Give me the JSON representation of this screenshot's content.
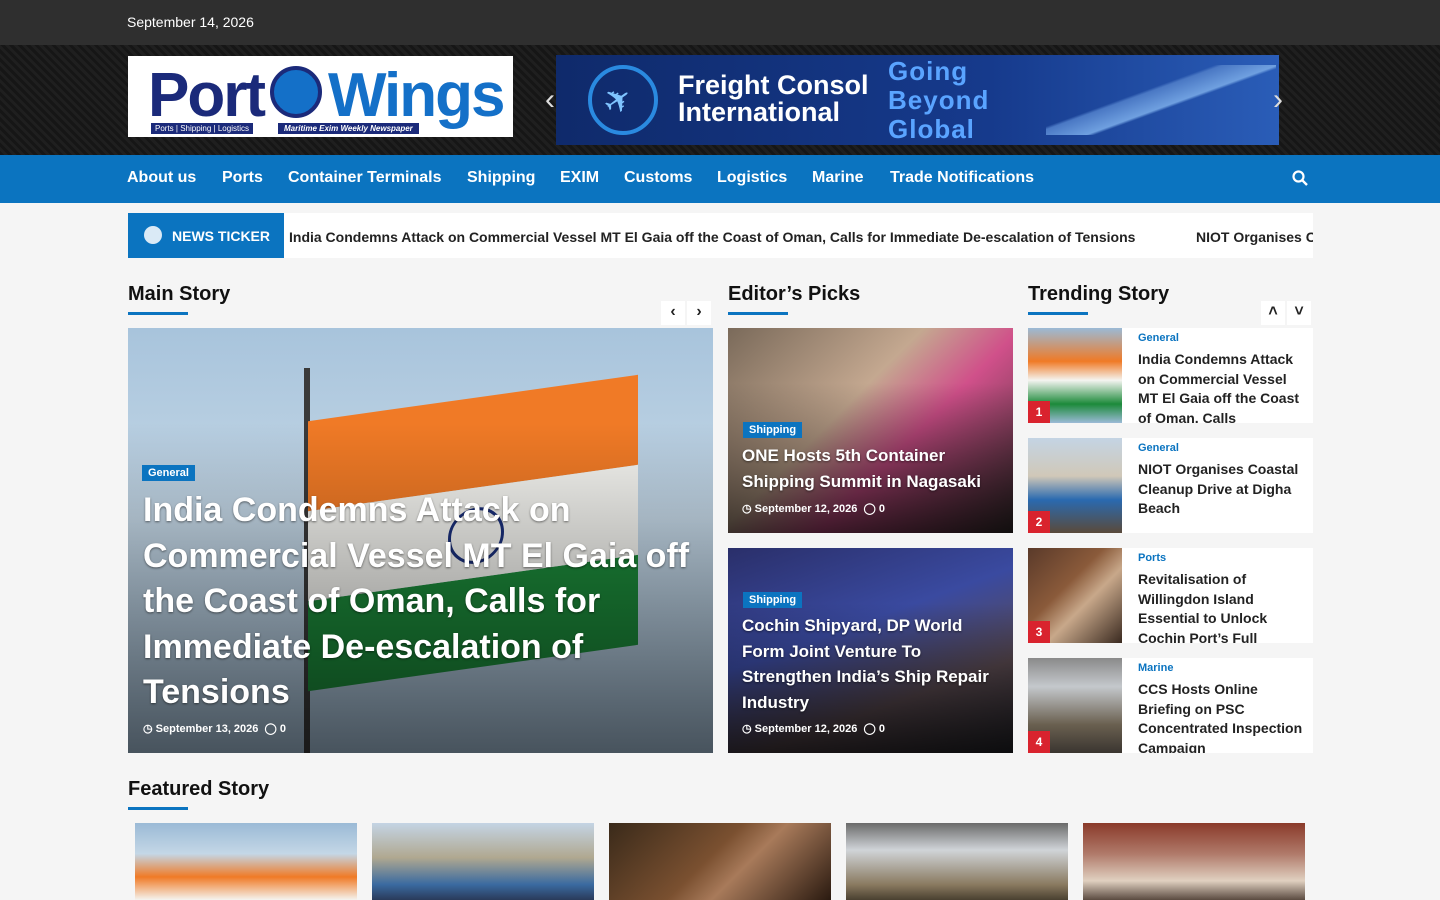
{
  "topbar": {
    "date": "September 14, 2026"
  },
  "logo": {
    "word1": "Port",
    "word2": "Wings",
    "tagline": "Ports | Shipping | Logistics",
    "subtitle": "Maritime Exim Weekly Newspaper"
  },
  "banner": {
    "brand_line1": "Freight Consol",
    "brand_line2": "International",
    "slogan_line1": "Going",
    "slogan_line2": "Beyond",
    "slogan_line3": "Global"
  },
  "nav": {
    "items": [
      "About us",
      "Ports",
      "Container Terminals",
      "Shipping",
      "EXIM",
      "Customs",
      "Logistics",
      "Marine",
      "Trade Notifications"
    ]
  },
  "ticker": {
    "label": "NEWS TICKER",
    "items": [
      "India Condemns Attack on Commercial Vessel MT El Gaia off the Coast of Oman, Calls for Immediate De-escalation of Tensions",
      "NIOT Organises Coastal Cleanup Drive at Digha Beach"
    ]
  },
  "sections": {
    "main": "Main Story",
    "editors": "Editor’s Picks",
    "trending": "Trending Story",
    "featured": "Featured Story"
  },
  "main_story": {
    "category": "General",
    "title": "India Condemns Attack on Commercial Vessel MT El Gaia off the Coast of Oman, Calls for Immediate De-escalation of Tensions",
    "date": "September 13, 2026",
    "comments": "0"
  },
  "editors_picks": [
    {
      "category": "Shipping",
      "title": "ONE Hosts 5th Container Shipping Summit in Nagasaki",
      "date": "September 12, 2026",
      "comments": "0"
    },
    {
      "category": "Shipping",
      "title": "Cochin Shipyard, DP World Form Joint Venture To Strengthen India’s Ship Repair Industry",
      "date": "September 12, 2026",
      "comments": "0"
    }
  ],
  "trending": [
    {
      "rank": "1",
      "category": "General",
      "title": "India Condemns Attack on Commercial Vessel MT El Gaia off the Coast of Oman, Calls"
    },
    {
      "rank": "2",
      "category": "General",
      "title": "NIOT Organises Coastal Cleanup Drive at Digha Beach"
    },
    {
      "rank": "3",
      "category": "Ports",
      "title": "Revitalisation of Willingdon Island Essential to Unlock Cochin Port’s Full"
    },
    {
      "rank": "4",
      "category": "Marine",
      "title": "CCS Hosts Online Briefing on PSC Concentrated Inspection Campaign"
    }
  ],
  "colors": {
    "accent": "#0b74c0",
    "topbar": "#2f2f2f",
    "rank_badge": "#d9232e"
  }
}
